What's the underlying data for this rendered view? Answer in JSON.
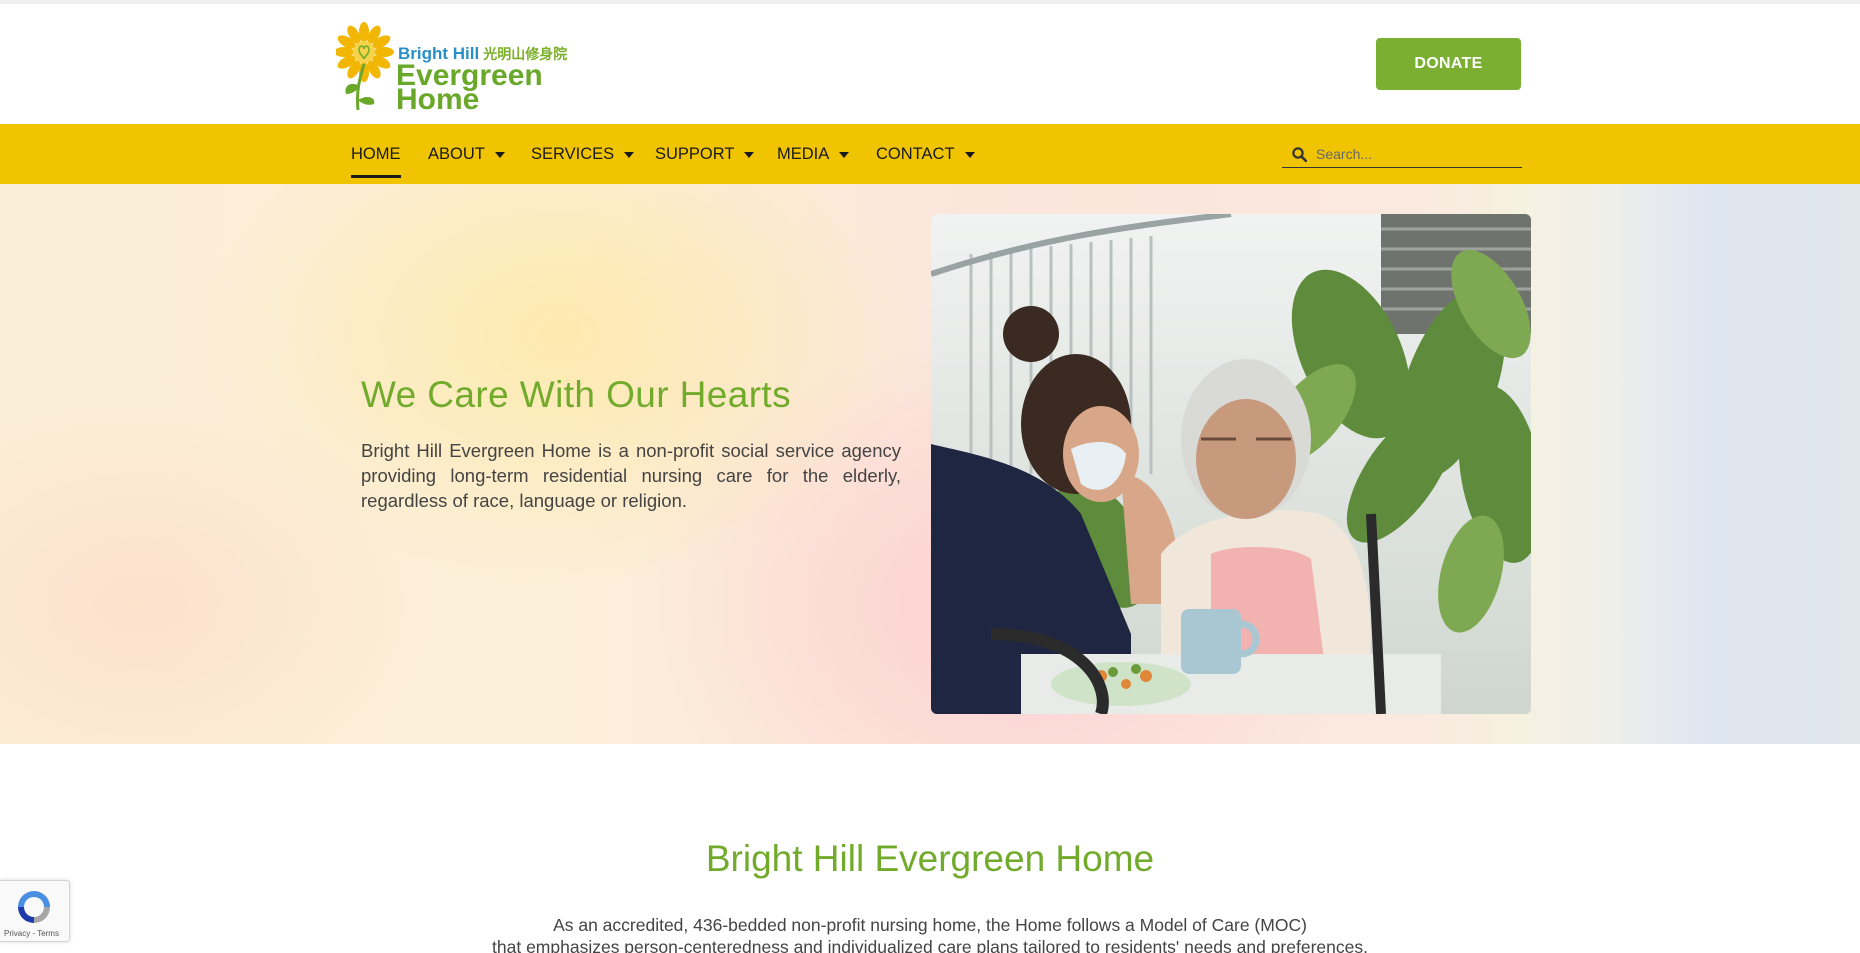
{
  "header": {
    "logo": {
      "name_en_top": "Bright Hill",
      "name_cn": "光明山修身院",
      "name_line1": "Evergreen",
      "name_line2": "Home"
    },
    "donate_label": "DONATE"
  },
  "nav": {
    "items": [
      {
        "label": "HOME",
        "active": true,
        "dropdown": false
      },
      {
        "label": "ABOUT",
        "dropdown": true
      },
      {
        "label": "SERVICES",
        "dropdown": true
      },
      {
        "label": "SUPPORT",
        "dropdown": true
      },
      {
        "label": "MEDIA",
        "dropdown": true
      },
      {
        "label": "CONTACT",
        "dropdown": true
      }
    ],
    "search": {
      "placeholder": "Search..."
    }
  },
  "hero": {
    "title": "We Care With Our Hearts",
    "body": "Bright Hill Evergreen Home is a non-profit social service agency providing long-term residential nursing care for the elderly, regardless of race, language or religion."
  },
  "about": {
    "title": "Bright Hill Evergreen Home",
    "intro_line1": "As an accredited, 436-bedded non-profit nursing home, the Home follows a Model of Care (MOC)",
    "intro_line2": "that emphasizes person-centeredness and individualized care plans tailored to residents' needs and preferences."
  },
  "recaptcha": {
    "terms": "Privacy - Terms"
  },
  "colors": {
    "brand_green": "#72ab2c",
    "donate_green": "#7aaf32",
    "nav_yellow": "#f0c400",
    "brand_blue": "#2a8fc7"
  }
}
